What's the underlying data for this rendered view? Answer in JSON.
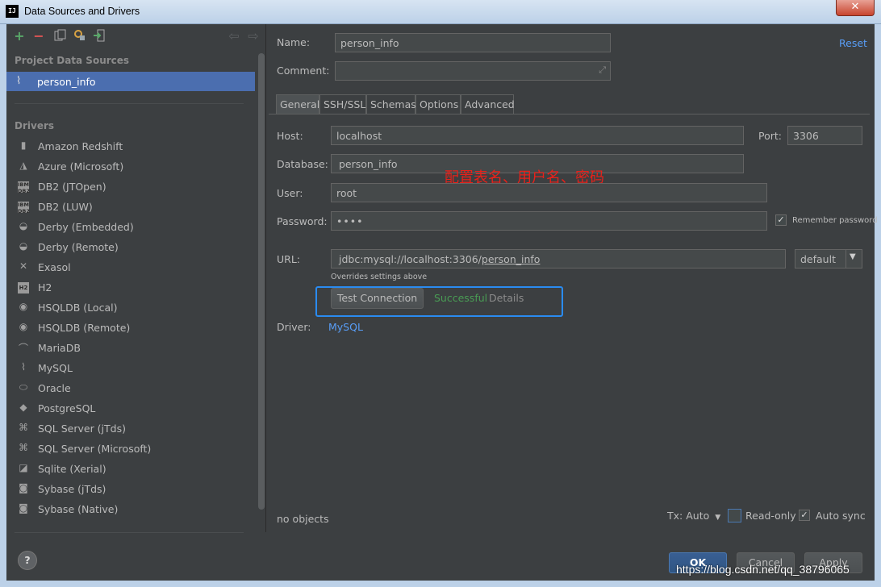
{
  "window": {
    "title": "Data Sources and Drivers",
    "app_icon_text": "IJ",
    "close_glyph": "✕"
  },
  "left": {
    "project_title": "Project Data Sources",
    "selected_source": "person_info",
    "drivers_title": "Drivers",
    "drivers": [
      {
        "label": "Amazon Redshift",
        "icon": "redshift-icon"
      },
      {
        "label": "Azure (Microsoft)",
        "icon": "azure-icon"
      },
      {
        "label": "DB2 (JTOpen)",
        "icon": "db2-icon"
      },
      {
        "label": "DB2 (LUW)",
        "icon": "db2-icon"
      },
      {
        "label": "Derby (Embedded)",
        "icon": "derby-icon"
      },
      {
        "label": "Derby (Remote)",
        "icon": "derby-icon"
      },
      {
        "label": "Exasol",
        "icon": "exasol-icon"
      },
      {
        "label": "H2",
        "icon": "h2-icon"
      },
      {
        "label": "HSQLDB (Local)",
        "icon": "hsqldb-icon"
      },
      {
        "label": "HSQLDB (Remote)",
        "icon": "hsqldb-icon"
      },
      {
        "label": "MariaDB",
        "icon": "mariadb-icon"
      },
      {
        "label": "MySQL",
        "icon": "mysql-icon"
      },
      {
        "label": "Oracle",
        "icon": "oracle-icon"
      },
      {
        "label": "PostgreSQL",
        "icon": "postgresql-icon"
      },
      {
        "label": "SQL Server (jTds)",
        "icon": "sqlserver-icon"
      },
      {
        "label": "SQL Server (Microsoft)",
        "icon": "sqlserver-icon"
      },
      {
        "label": "Sqlite (Xerial)",
        "icon": "sqlite-icon"
      },
      {
        "label": "Sybase (jTds)",
        "icon": "sybase-icon"
      },
      {
        "label": "Sybase (Native)",
        "icon": "sybase-icon"
      }
    ],
    "db2_badge": "IBM DB2",
    "h2_badge": "H2",
    "help_glyph": "?"
  },
  "form": {
    "name_label": "Name:",
    "name_value": "person_info",
    "comment_label": "Comment:",
    "comment_value": "",
    "reset_label": "Reset",
    "tabs": [
      "General",
      "SSH/SSL",
      "Schemas",
      "Options",
      "Advanced"
    ],
    "host_label": "Host:",
    "host_value": "localhost",
    "port_label": "Port:",
    "port_value": "3306",
    "database_label": "Database:",
    "database_value": "person_info",
    "user_label": "User:",
    "user_value": "root",
    "password_label": "Password:",
    "password_value": "••••",
    "remember_label": "Remember password",
    "url_label": "URL:",
    "url_prefix": "jdbc:mysql://localhost:3306/",
    "url_db": "person_info",
    "url_mode": "default",
    "overrides_note": "Overrides settings above",
    "test_button": "Test Connection",
    "status": "Successful",
    "details_link": "Details",
    "driver_label": "Driver:",
    "driver_value": "MySQL",
    "annotation": "配置表名、用户名、密码"
  },
  "footer": {
    "objects": "no objects",
    "tx_mode": "Tx: Auto",
    "readonly_label": "Read-only",
    "autosync_label": "Auto sync",
    "ok": "OK",
    "cancel": "Cancel",
    "apply": "Apply"
  },
  "watermark": "https://blog.csdn.net/qq_38796065",
  "colors": {
    "accent": "#4b6eaf",
    "link": "#589df6",
    "success": "#499c54",
    "annotation": "#e8211a",
    "highlight": "#2a8bf0"
  }
}
